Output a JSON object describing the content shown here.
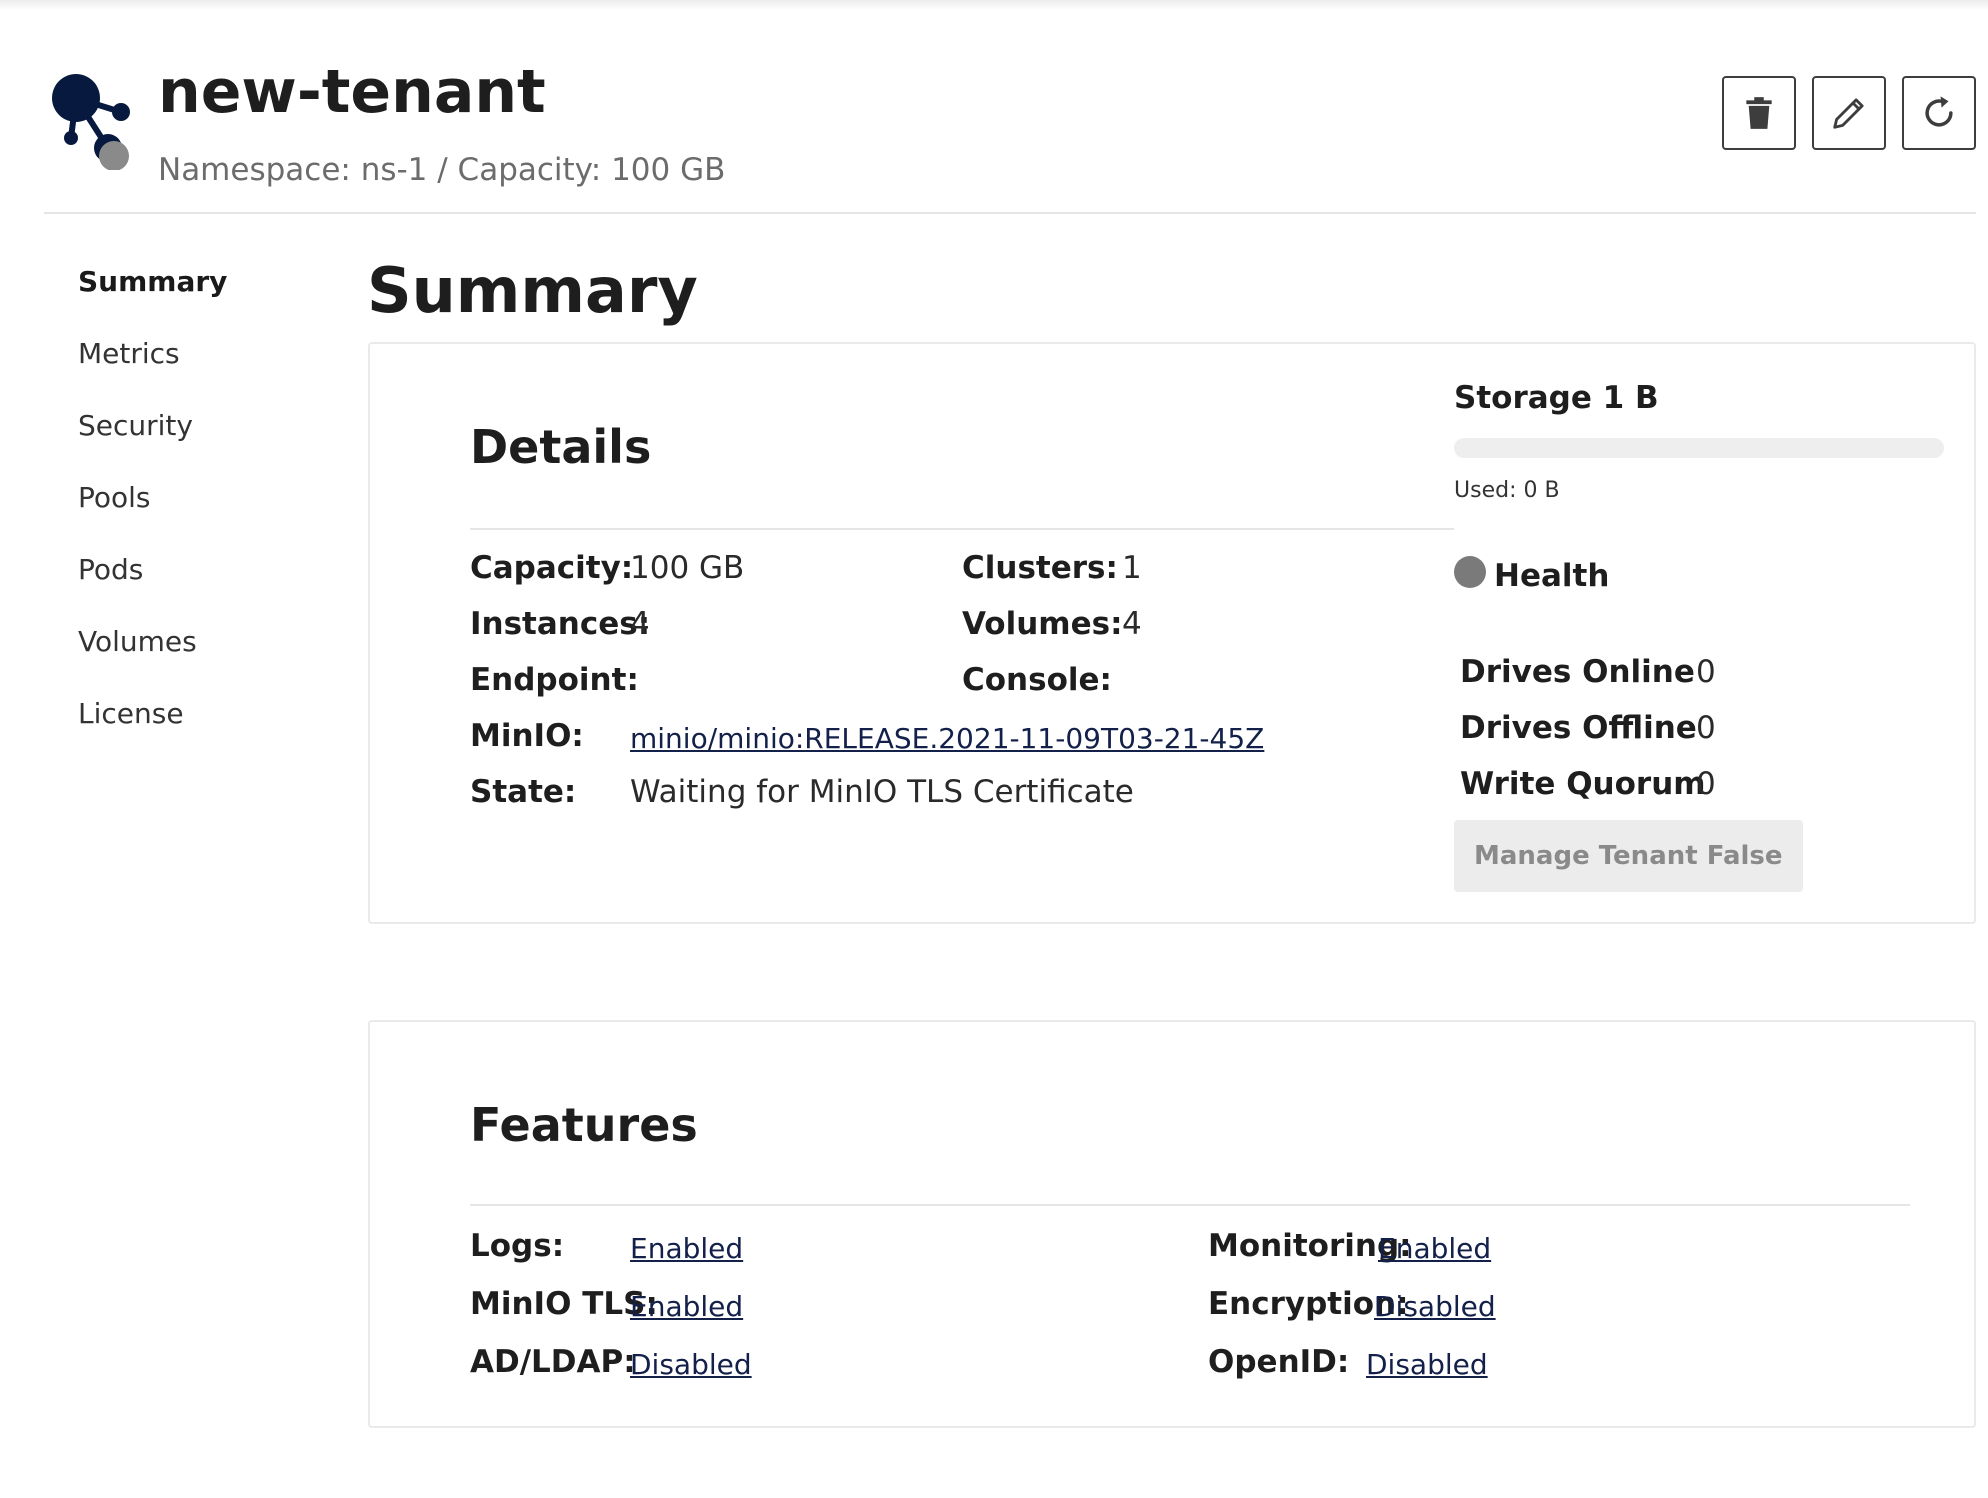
{
  "header": {
    "title": "new-tenant",
    "subtitle": "Namespace: ns-1 / Capacity: 100 GB",
    "actions": {
      "delete_icon": "trash-icon",
      "edit_icon": "pencil-icon",
      "refresh_icon": "refresh-icon"
    }
  },
  "sidebar": {
    "items": [
      {
        "label": "Summary",
        "active": true
      },
      {
        "label": "Metrics",
        "active": false
      },
      {
        "label": "Security",
        "active": false
      },
      {
        "label": "Pools",
        "active": false
      },
      {
        "label": "Pods",
        "active": false
      },
      {
        "label": "Volumes",
        "active": false
      },
      {
        "label": "License",
        "active": false
      }
    ]
  },
  "main": {
    "heading": "Summary",
    "details": {
      "title": "Details",
      "capacity_label": "Capacity:",
      "capacity_value": "100 GB",
      "clusters_label": "Clusters:",
      "clusters_value": "1",
      "instances_label": "Instances:",
      "instances_value": "4",
      "volumes_label": "Volumes:",
      "volumes_value": "4",
      "endpoint_label": "Endpoint:",
      "console_label": "Console:",
      "minio_label": "MinIO:",
      "minio_value": "minio/minio:RELEASE.2021-11-09T03-21-45Z",
      "state_label": "State:",
      "state_value": "Waiting for MinIO TLS Certificate"
    },
    "storage": {
      "title": "Storage 1 B",
      "used_label": "Used: 0 B",
      "used_fraction": 0
    },
    "health": {
      "label": "Health",
      "status_color": "#7a7a7a",
      "drives_online_label": "Drives Online",
      "drives_online_value": "0",
      "drives_offline_label": "Drives Offline",
      "drives_offline_value": "0",
      "write_quorum_label": "Write Quorum",
      "write_quorum_value": "0",
      "manage_button_label": "Manage Tenant False"
    },
    "features": {
      "title": "Features",
      "logs_label": "Logs:",
      "logs_value": "Enabled",
      "minio_tls_label": "MinIO TLS:",
      "minio_tls_value": "Enabled",
      "ad_ldap_label": "AD/LDAP:",
      "ad_ldap_value": "Disabled",
      "monitoring_label": "Monitoring:",
      "monitoring_value": "Enabled",
      "encryption_label": "Encryption:",
      "encryption_value": "Disabled",
      "openid_label": "OpenID:",
      "openid_value": "Disabled"
    }
  },
  "colors": {
    "brand_navy": "#07193e",
    "link": "#13204a",
    "status_gray": "#7a7a7a"
  }
}
